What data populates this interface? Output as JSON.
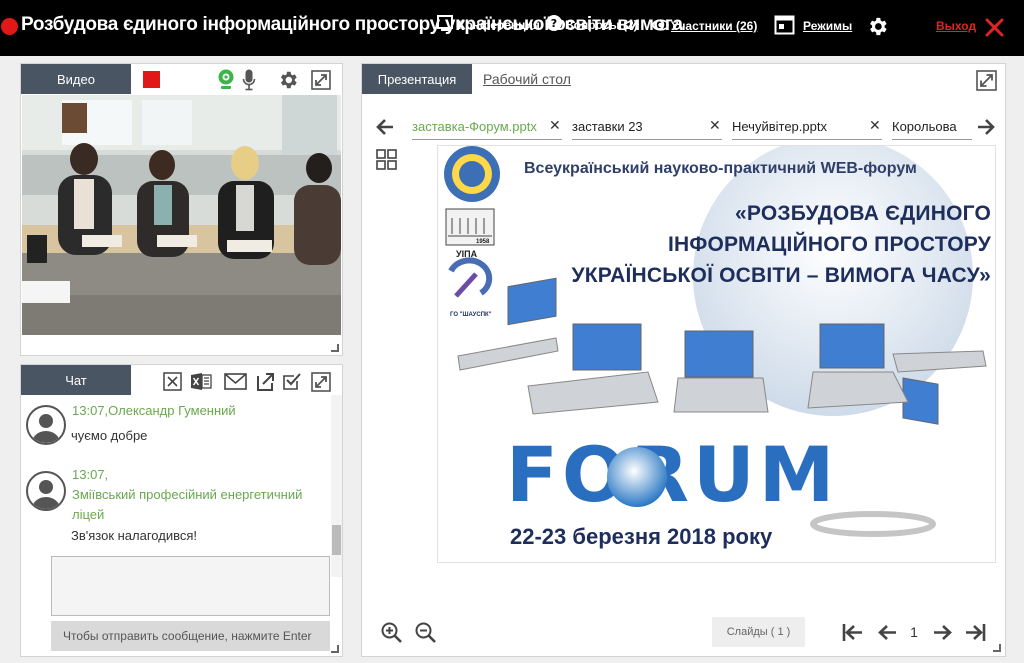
{
  "header": {
    "title": "Розбудова єдиного інформаційного простору української освіти вимога",
    "overlap_a": "Конференция",
    "overlap_b": "Вопросы (2)",
    "participants_label": "Участники (26)",
    "modes_label": "Режимы",
    "exit_label": "Выход"
  },
  "video": {
    "tab_label": "Видео"
  },
  "chat": {
    "tab_label": "Чат",
    "messages": [
      {
        "time": "13:07,",
        "author": "Олександр Гуменний",
        "text": "чуємо добре"
      },
      {
        "time": "13:07,",
        "author": "Зміївський професійний енергетичний ліцей",
        "text": "Зв'язок налагодився!"
      }
    ],
    "send_hint": "Чтобы отправить сообщение, нажмите Enter"
  },
  "presentation": {
    "tab_label": "Презентация",
    "desktop_label": "Рабочий стол",
    "files": [
      {
        "name": "заставка-Форум.pptx"
      },
      {
        "name": "заставки 23"
      },
      {
        "name": "Нечуйвітер.pptx"
      },
      {
        "name": "Корольова"
      }
    ],
    "slide": {
      "heading": "Всеукраїнський науково-практичний WEB-форум",
      "title_line1": "«РОЗБУДОВА  ЄДИНОГО",
      "title_line2": "ІНФОРМАЦІЙНОГО ПРОСТОРУ",
      "title_line3": "УКРАЇНСЬКОЇ ОСВІТИ – ВИМОГА ЧАСУ»",
      "logo_year": "1958",
      "logo_abbr": "УІПА",
      "logo_org": "ГО \"ШАУСПК\"",
      "forum_word": "FORUM",
      "date": "22-23 березня 2018 року"
    },
    "slides_counter": "Слайды (  1  )",
    "page": "1"
  },
  "colors": {
    "accent_green": "#6aa84f",
    "record_red": "#e01818",
    "tab_bg": "#4a5563",
    "exit_red": "#e02424"
  }
}
